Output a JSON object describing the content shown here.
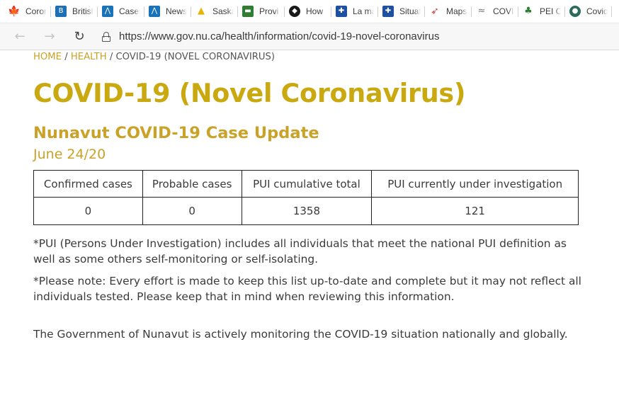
{
  "browser": {
    "tabs": [
      {
        "label": "Coron",
        "icon": "maple-leaf-icon",
        "color": "#d52b1e",
        "glyph": "✦"
      },
      {
        "label": "British",
        "icon": "bc-gov-icon",
        "color": "#1f6fb2",
        "glyph": "B"
      },
      {
        "label": "Cases",
        "icon": "health-chart-icon",
        "color": "#1a72b8",
        "glyph": "⋀"
      },
      {
        "label": "News",
        "icon": "health-chart-icon",
        "color": "#1a72b8",
        "glyph": "⋀"
      },
      {
        "label": "Saska",
        "icon": "saskatchewan-icon",
        "color": "#e8b400",
        "glyph": "▲"
      },
      {
        "label": "Provi",
        "icon": "manitoba-icon",
        "color": "#2e7d32",
        "glyph": "▬"
      },
      {
        "label": "How",
        "icon": "ontario-icon",
        "color": "#1a1a1a",
        "glyph": "◆"
      },
      {
        "label": "La ma",
        "icon": "quebec-fleur-icon",
        "color": "#1e4fa0",
        "glyph": "✚"
      },
      {
        "label": "Situat",
        "icon": "quebec-fleur-icon",
        "color": "#1e4fa0",
        "glyph": "✚"
      },
      {
        "label": "Maps",
        "icon": "maps-icon",
        "color": "#c0392b",
        "glyph": "➶"
      },
      {
        "label": "COVII",
        "icon": "newfoundland-icon",
        "color": "#7a7a7a",
        "glyph": "≈"
      },
      {
        "label": "PEI C",
        "icon": "pei-icon",
        "color": "#2e7d32",
        "glyph": "♣"
      },
      {
        "label": "Covid",
        "icon": "yukon-icon",
        "color": "#2b6b5e",
        "glyph": "●"
      }
    ],
    "nav": {
      "back": "←",
      "forward": "→",
      "reload": "↻"
    },
    "url": "https://www.gov.nu.ca/health/information/covid-19-novel-coronavirus"
  },
  "page": {
    "breadcrumb": {
      "home": "HOME",
      "sep1": " / ",
      "health": "HEALTH",
      "sep2": " / ",
      "current": "COVID-19 (NOVEL CORONAVIRUS)"
    },
    "title": "COVID-19 (Novel Coronavirus)",
    "subtitle": "Nunavut COVID-19 Case Update",
    "date": "June 24/20",
    "table": {
      "headers": [
        "Confirmed cases",
        "Probable cases",
        "PUI cumulative total",
        "PUI currently under investigation"
      ],
      "rows": [
        [
          "0",
          "0",
          "1358",
          "121"
        ]
      ]
    },
    "note_pui": "*PUI (Persons Under Investigation) includes all individuals that meet the national PUI definition as well as some others self-monitoring or self-isolating.",
    "note_disclaimer": "*Please note: Every effort is made to keep this list up-to-date and complete but it may not reflect all individuals tested. Please keep that in mind when reviewing this information.",
    "monitoring": "The Government of Nunavut is actively monitoring the COVID-19 situation nationally and globally."
  },
  "colors": {
    "accent_gold": "#c9a90f",
    "link_gold": "#c9a227",
    "text": "#3a3a3a"
  }
}
